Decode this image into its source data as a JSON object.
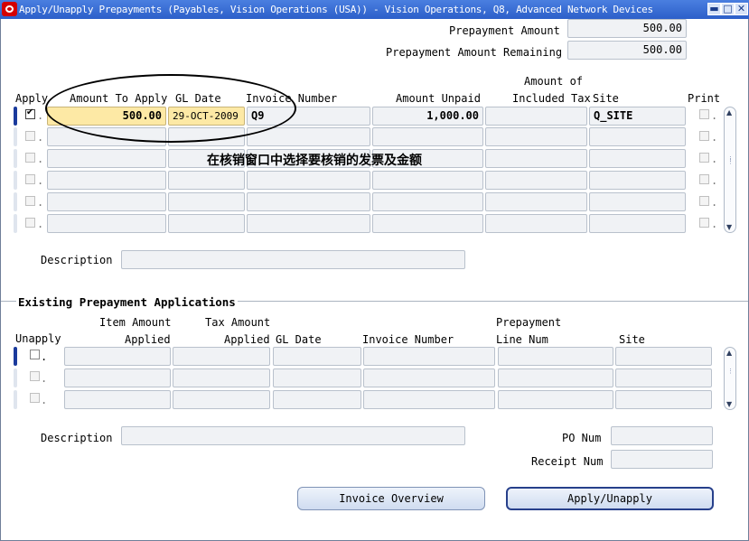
{
  "window": {
    "title": "Apply/Unapply Prepayments (Payables, Vision Operations (USA)) - Vision Operations, Q8, Advanced Network Devices",
    "minimize_glyph": "▬",
    "maximize_glyph": "□",
    "close_glyph": "✕"
  },
  "header": {
    "prepayment_amount_label": "Prepayment Amount",
    "prepayment_amount_value": "500.00",
    "prepayment_remaining_label": "Prepayment Amount Remaining",
    "prepayment_remaining_value": "500.00"
  },
  "apply_table": {
    "headers": {
      "apply": "Apply",
      "amount_to_apply": "Amount To Apply",
      "gl_date": "GL Date",
      "invoice_number": "Invoice Number",
      "amount_unpaid": "Amount  Unpaid",
      "amount_of": "Amount  of",
      "included_tax": "Included Tax",
      "site": "Site",
      "print": "Print"
    },
    "rows": [
      {
        "apply": true,
        "amount_to_apply": "500.00",
        "gl_date": "29-OCT-2009",
        "invoice_number": "Q9",
        "amount_unpaid": "1,000.00",
        "included_tax": "",
        "site": "Q_SITE",
        "print": false
      },
      {
        "apply": false,
        "amount_to_apply": "",
        "gl_date": "",
        "invoice_number": "",
        "amount_unpaid": "",
        "included_tax": "",
        "site": "",
        "print": false
      },
      {
        "apply": false,
        "amount_to_apply": "",
        "gl_date": "",
        "invoice_number": "",
        "amount_unpaid": "",
        "included_tax": "",
        "site": "",
        "print": false
      },
      {
        "apply": false,
        "amount_to_apply": "",
        "gl_date": "",
        "invoice_number": "",
        "amount_unpaid": "",
        "included_tax": "",
        "site": "",
        "print": false
      },
      {
        "apply": false,
        "amount_to_apply": "",
        "gl_date": "",
        "invoice_number": "",
        "amount_unpaid": "",
        "included_tax": "",
        "site": "",
        "print": false
      },
      {
        "apply": false,
        "amount_to_apply": "",
        "gl_date": "",
        "invoice_number": "",
        "amount_unpaid": "",
        "included_tax": "",
        "site": "",
        "print": false
      }
    ],
    "description_label": "Description",
    "description_value": ""
  },
  "annotation": "在核销窗口中选择要核销的发票及金额",
  "existing": {
    "section_title": "Existing Prepayment Applications",
    "headers": {
      "unapply": "Unapply",
      "item_amount": "Item Amount",
      "applied1": "Applied",
      "tax_amount": "Tax Amount",
      "applied2": "Applied",
      "gl_date": "GL Date",
      "invoice_number": "Invoice Number",
      "prepayment": "Prepayment",
      "line_num": "Line Num",
      "site": "Site"
    },
    "rows": [
      {
        "unapply": false
      },
      {
        "unapply": false
      },
      {
        "unapply": false
      }
    ],
    "description_label": "Description",
    "description_value": "",
    "po_num_label": "PO Num",
    "po_num_value": "",
    "receipt_num_label": "Receipt Num",
    "receipt_num_value": ""
  },
  "buttons": {
    "invoice_overview": "Invoice Overview",
    "apply_unapply": "Apply/Unapply"
  }
}
